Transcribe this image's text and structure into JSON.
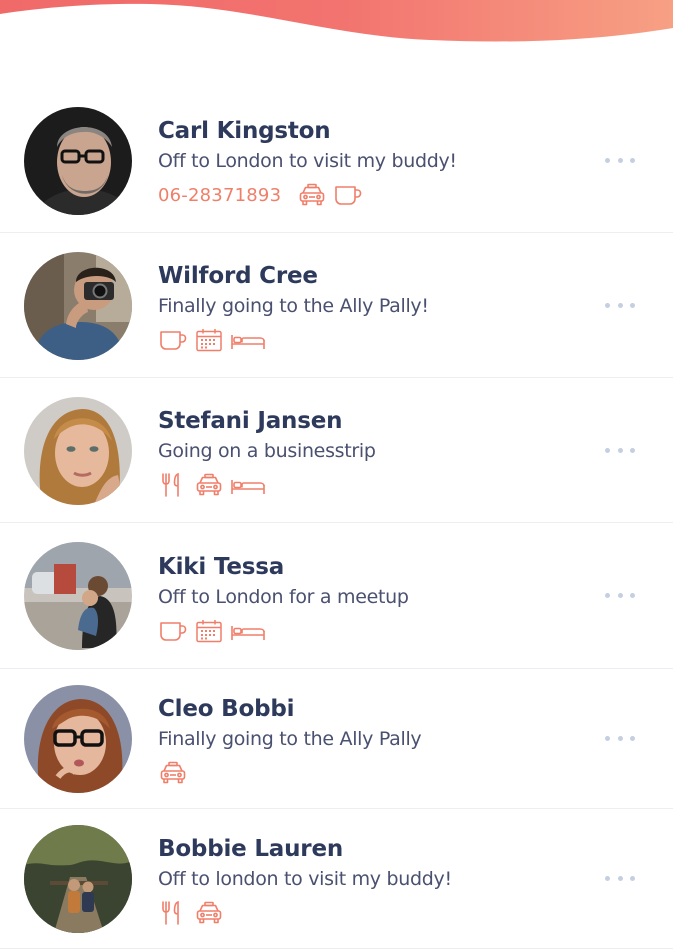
{
  "colors": {
    "header_gradient_start": "#f26d6d",
    "header_gradient_end": "#f59a7e",
    "name_text": "#2e3a5c",
    "status_text": "#4a5070",
    "accent_icon": "#f07f6a",
    "more_dots": "#c5cfe2",
    "divider": "#eceef2"
  },
  "contacts": [
    {
      "name": "Carl Kingston",
      "status": "Off to London to visit my buddy!",
      "phone": "06-28371893",
      "icons": [
        "taxi-icon",
        "coffee-cup-icon"
      ]
    },
    {
      "name": "Wilford Cree",
      "status": "Finally going to the Ally Pally!",
      "phone": "",
      "icons": [
        "coffee-cup-icon",
        "calendar-icon",
        "bed-icon"
      ]
    },
    {
      "name": "Stefani Jansen",
      "status": "Going on a businesstrip",
      "phone": "",
      "icons": [
        "fork-knife-icon",
        "taxi-icon",
        "bed-icon"
      ]
    },
    {
      "name": "Kiki Tessa",
      "status": "Off to London for a meetup",
      "phone": "",
      "icons": [
        "coffee-cup-icon",
        "calendar-icon",
        "bed-icon"
      ]
    },
    {
      "name": "Cleo Bobbi",
      "status": "Finally going to the Ally Pally",
      "phone": "",
      "icons": [
        "taxi-icon"
      ]
    },
    {
      "name": "Bobbie Lauren",
      "status": "Off to london to visit my buddy!",
      "phone": "",
      "icons": [
        "fork-knife-icon",
        "taxi-icon"
      ]
    }
  ]
}
